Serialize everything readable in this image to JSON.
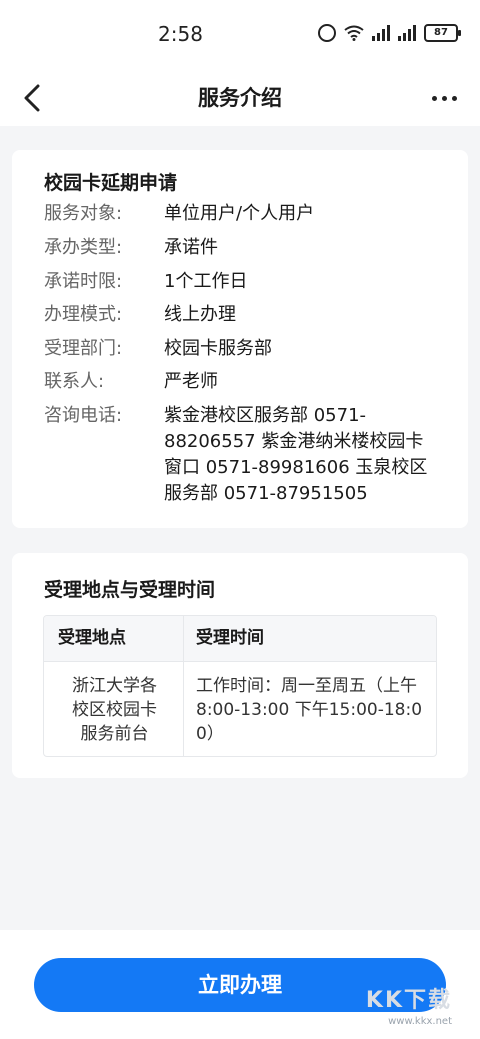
{
  "status_bar": {
    "time": "2:58",
    "battery": "87"
  },
  "nav": {
    "title": "服务介绍"
  },
  "service": {
    "title": "校园卡延期申请",
    "rows": [
      {
        "key": "服务对象:",
        "value": "单位用户/个人用户"
      },
      {
        "key": "承办类型:",
        "value": "承诺件"
      },
      {
        "key": "承诺时限:",
        "value": "1个工作日"
      },
      {
        "key": "办理模式:",
        "value": "线上办理"
      },
      {
        "key": "受理部门:",
        "value": "校园卡服务部"
      },
      {
        "key": "联系人:",
        "value": "严老师"
      },
      {
        "key": "咨询电话:",
        "value": "紫金港校区服务部 0571-88206557 紫金港纳米楼校园卡窗口 0571-89981606 玉泉校区服务部 0571-87951505"
      }
    ]
  },
  "location": {
    "title": "受理地点与受理时间",
    "headers": [
      "受理地点",
      "受理时间"
    ],
    "cell_place": "浙江大学各校区校园卡服务前台",
    "cell_time": "工作时间：周一至周五（上午8:00-13:00 下午15:00-18:00）"
  },
  "footer": {
    "button_label": "立即办理",
    "watermark_logo": "KK下载",
    "watermark_url": "www.kkx.net"
  }
}
